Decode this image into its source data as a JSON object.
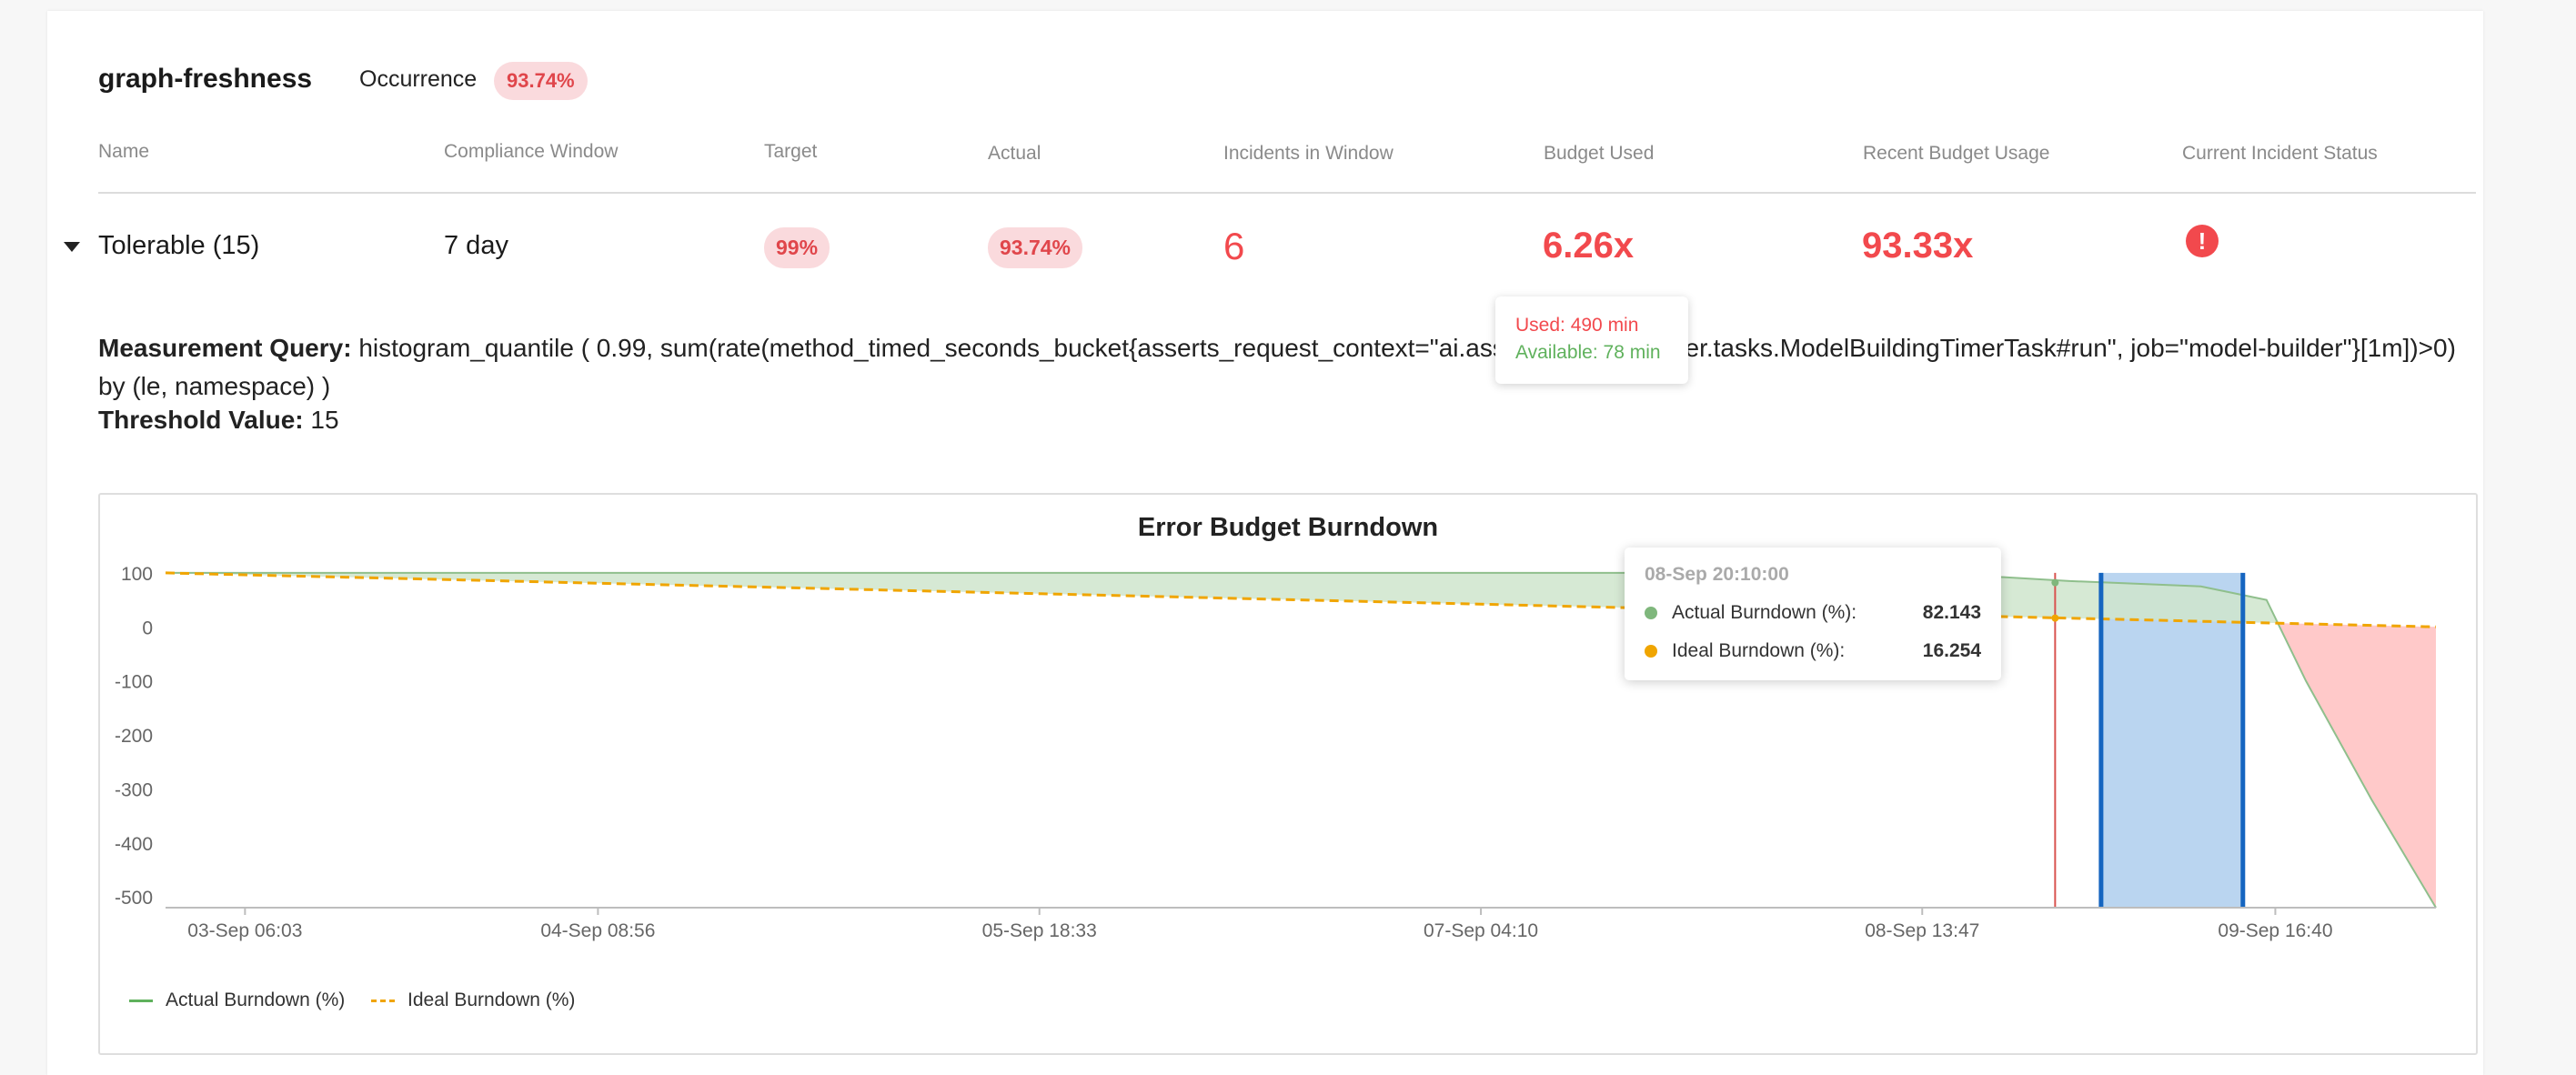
{
  "slo": {
    "name": "graph-freshness",
    "occurrence_label": "Occurrence",
    "occurrence_value": "93.74%"
  },
  "table": {
    "headers": [
      "Name",
      "Compliance Window",
      "Target",
      "Actual",
      "Incidents in Window",
      "Budget Used",
      "Recent Budget Usage",
      "Current Incident Status"
    ],
    "row": {
      "name": "Tolerable (15)",
      "window": "7 day",
      "target": "99%",
      "actual": "93.74%",
      "incidents": "6",
      "budget_used": "6.26x",
      "recent_budget_usage": "93.33x",
      "status_icon": "alert-icon"
    }
  },
  "query": {
    "label": "Measurement Query:",
    "text": "histogram_quantile ( 0.99, sum(rate(method_timed_seconds_bucket{asserts_request_context=\"ai.asserts.model.builder.tasks.ModelBuildingTimerTask#run\", job=\"model-builder\"}[1m])>0) by (le, namespace) )",
    "threshold_label": "Threshold Value:",
    "threshold_value": "15"
  },
  "budget_tooltip": {
    "used": "Used: 490 min",
    "available": "Available: 78 min"
  },
  "colors": {
    "red": "#f2494d",
    "green": "#5fb15c",
    "actual_line": "#8fbf8c",
    "ideal_line": "#f0a500",
    "selection": "#1565c0",
    "pill_bg": "#fadadd"
  },
  "chart_data": {
    "type": "area",
    "title": "Error Budget Burndown",
    "ylim": [
      -520,
      100
    ],
    "y_ticks": [
      100,
      0,
      -100,
      -200,
      -300,
      -400,
      -500
    ],
    "x_tick_labels": [
      "03-Sep 06:03",
      "04-Sep 08:56",
      "05-Sep 18:33",
      "07-Sep 04:10",
      "08-Sep 13:47",
      "09-Sep 16:40"
    ],
    "x_tick_hours": [
      6.05,
      32.93,
      66.55,
      100.17,
      133.78,
      160.67
    ],
    "x_range_hours": [
      0,
      172.9
    ],
    "series": [
      {
        "name": "Actual Burndown (%)",
        "color": "#8fbf8c",
        "x_hours": [
          0,
          20,
          60,
          100,
          132,
          140,
          145,
          150,
          155,
          160,
          163,
          168,
          172.9
        ],
        "values": [
          100,
          100,
          100,
          100,
          100,
          92,
          85,
          80,
          75,
          50,
          -100,
          -320,
          -520
        ]
      },
      {
        "name": "Ideal Burndown (%)",
        "color": "#f0a500",
        "dashed": true,
        "x_hours": [
          0,
          172.9
        ],
        "values": [
          100,
          0
        ]
      }
    ],
    "legend": [
      "Actual Burndown (%)",
      "Ideal Burndown (%)"
    ],
    "legend_position": "bottom-left",
    "grid": false,
    "highlight_range_hours": [
      147.4,
      158.2
    ],
    "marker_hours": 143.9,
    "tooltip": {
      "date": "08-Sep 20:10:00",
      "rows": [
        {
          "label": "Actual Burndown (%):",
          "value": "82.143",
          "color": "#5fb15c"
        },
        {
          "label": "Ideal Burndown (%):",
          "value": "16.254",
          "color": "#f0a500"
        }
      ]
    }
  }
}
